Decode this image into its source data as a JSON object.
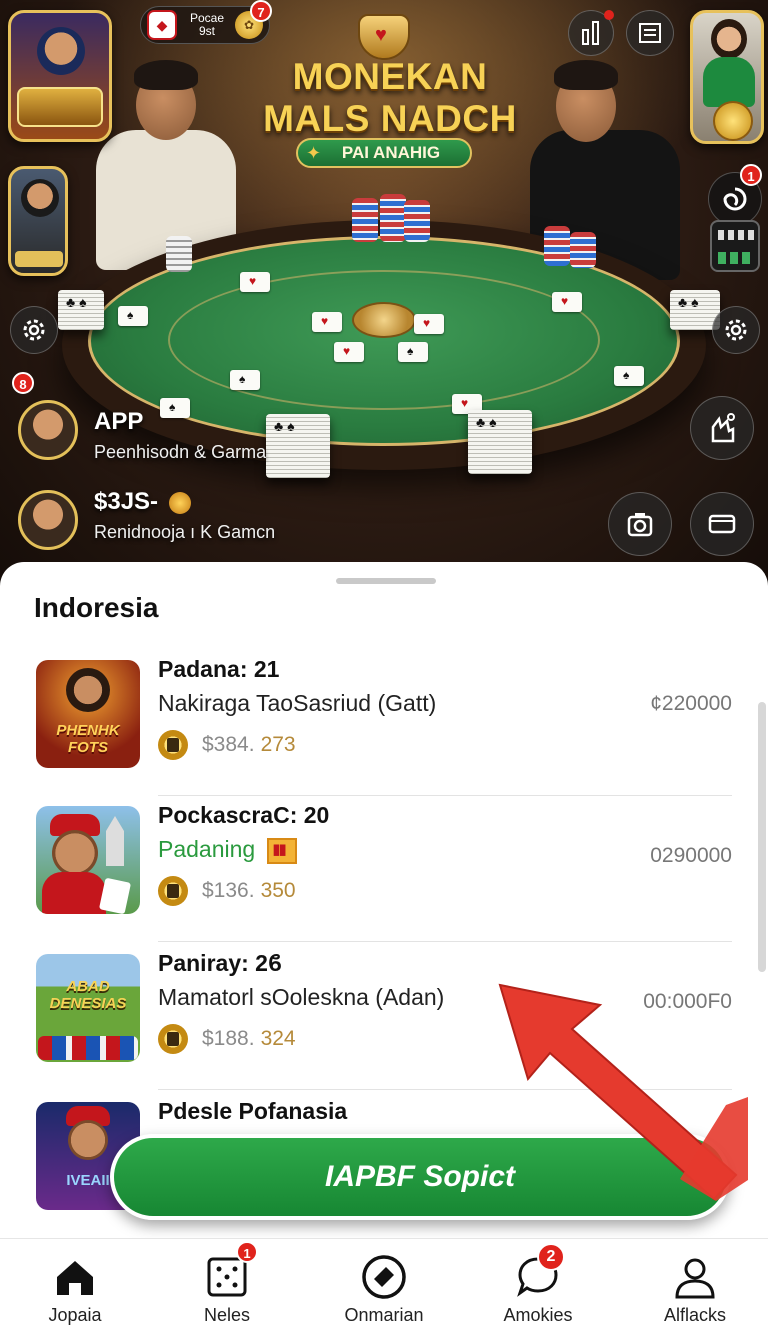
{
  "hero": {
    "title_line1": "MONEKAN",
    "title_line2": "MALS NADCH",
    "subtitle": "PAI ANAHIG",
    "promo": {
      "label_line1": "Pocae",
      "label_line2": "9st",
      "badge": "7"
    },
    "side_badge": "1",
    "left_badge": "8",
    "player1": {
      "name": "APP",
      "subtitle": "Peenhisodn & Garma"
    },
    "player2": {
      "name": "$3JS-",
      "subtitle": "Renidnooja ı K Gamcn"
    }
  },
  "sheet": {
    "title": "Indoresia",
    "items": [
      {
        "title": "Padana: 21",
        "subtitle": "Nakiraga TaoSasriud (Gatt)",
        "price": "$384.",
        "amount": "273",
        "right_value": "¢220000",
        "thumb_text": "PHENHK FOTS"
      },
      {
        "title": "PockascraC: 20",
        "subtitle": "Padaning",
        "price": "$136.",
        "amount": "350",
        "right_value": "0290000"
      },
      {
        "title": "Paniray: 2ϐ",
        "subtitle": "Mamatorl sOoleskna (Adan)",
        "price": "$188.",
        "amount": "324",
        "right_value": "00:000F0",
        "thumb_text": "ABAD DENESIAS"
      },
      {
        "title": "Pdesle Pofanasia",
        "thumb_text": "IVEAII"
      }
    ],
    "cta_label": "IAPBF Sopict"
  },
  "nav": {
    "items": [
      {
        "label": "Jopaia",
        "badge": ""
      },
      {
        "label": "Neles",
        "badge": "1"
      },
      {
        "label": "Onmarian",
        "badge": ""
      },
      {
        "label": "Amokies",
        "badge": "2"
      },
      {
        "label": "Alflacks",
        "badge": ""
      }
    ]
  },
  "colors": {
    "accent_green": "#1f9a3f",
    "gold": "#e7c15b",
    "badge_red": "#e0231c",
    "arrow_red": "#e53a2e"
  }
}
